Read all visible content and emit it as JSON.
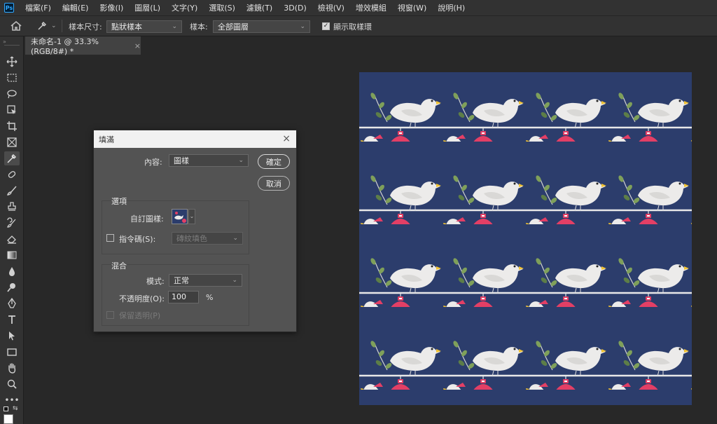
{
  "app": {
    "logo_text": "Ps"
  },
  "menu": [
    "檔案(F)",
    "編輯(E)",
    "影像(I)",
    "圖層(L)",
    "文字(Y)",
    "選取(S)",
    "濾鏡(T)",
    "3D(D)",
    "檢視(V)",
    "增效模組",
    "視窗(W)",
    "說明(H)"
  ],
  "options": {
    "sample_size_label": "樣本尺寸:",
    "sample_size_value": "點狀樣本",
    "sample_label": "樣本:",
    "sample_value": "全部圖層",
    "show_ring_label": "顯示取樣環",
    "show_ring_checked": true
  },
  "document_tab": {
    "title": "未命名-1 @ 33.3% (RGB/8#) *",
    "close": "×"
  },
  "tools": [
    "move-tool",
    "marquee-tool",
    "lasso-tool",
    "object-select-tool",
    "crop-tool",
    "frame-tool",
    "eyedropper-tool",
    "healing-brush-tool",
    "brush-tool",
    "clone-stamp-tool",
    "history-brush-tool",
    "eraser-tool",
    "gradient-tool",
    "blur-tool",
    "dodge-tool",
    "pen-tool",
    "type-tool",
    "path-select-tool",
    "rectangle-tool",
    "hand-tool",
    "zoom-tool",
    "more-tools"
  ],
  "colors": {
    "canvas_bg": "#2c3d6c",
    "bird": "#ecebea",
    "ornament": "#e33f65",
    "leaf": "#7fa05a",
    "beak": "#f1c232"
  },
  "fill_dialog": {
    "title": "填滿",
    "close": "×",
    "contents_label": "內容:",
    "contents_value": "圖樣",
    "ok": "確定",
    "cancel": "取消",
    "options_group": "選項",
    "custom_pattern_label": "自訂圖樣:",
    "script_label": "指令碼(S):",
    "script_value": "磚紋填色",
    "script_checked": false,
    "blending_group": "混合",
    "mode_label": "模式:",
    "mode_value": "正常",
    "opacity_label": "不透明度(O):",
    "opacity_value": "100",
    "opacity_unit": "%",
    "preserve_label": "保留透明(P)",
    "preserve_checked": false
  }
}
